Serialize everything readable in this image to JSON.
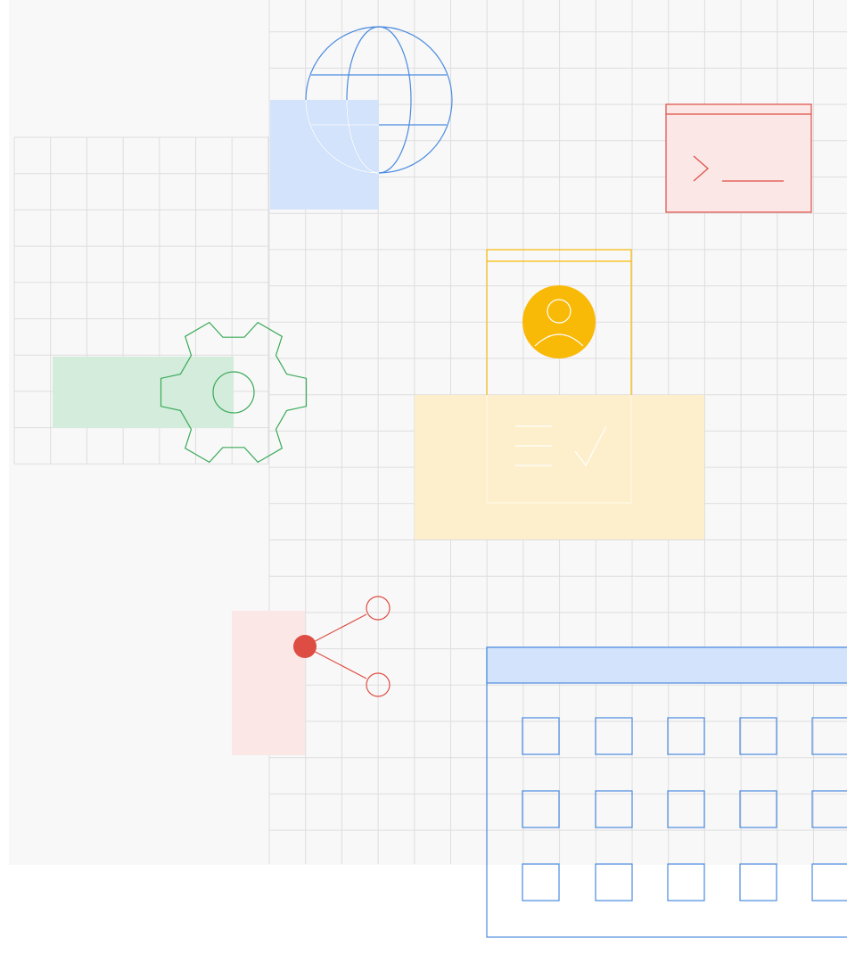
{
  "illustration": {
    "icons": [
      "globe-icon",
      "terminal-window-icon",
      "user-profile-document-icon",
      "gear-icon",
      "share-icon",
      "calendar-icon"
    ]
  },
  "colors": {
    "background": "#f8f8f8",
    "grid_line": "#dedede",
    "blue": "#4a8ae0",
    "blue_fill": "#d3e3fb",
    "red": "#de4d43",
    "red_fill": "#fbe7e6",
    "green": "#3aaa58",
    "green_fill": "#d4ecdc",
    "yellow": "#f9b907",
    "yellow_fill": "#fdefcb"
  }
}
